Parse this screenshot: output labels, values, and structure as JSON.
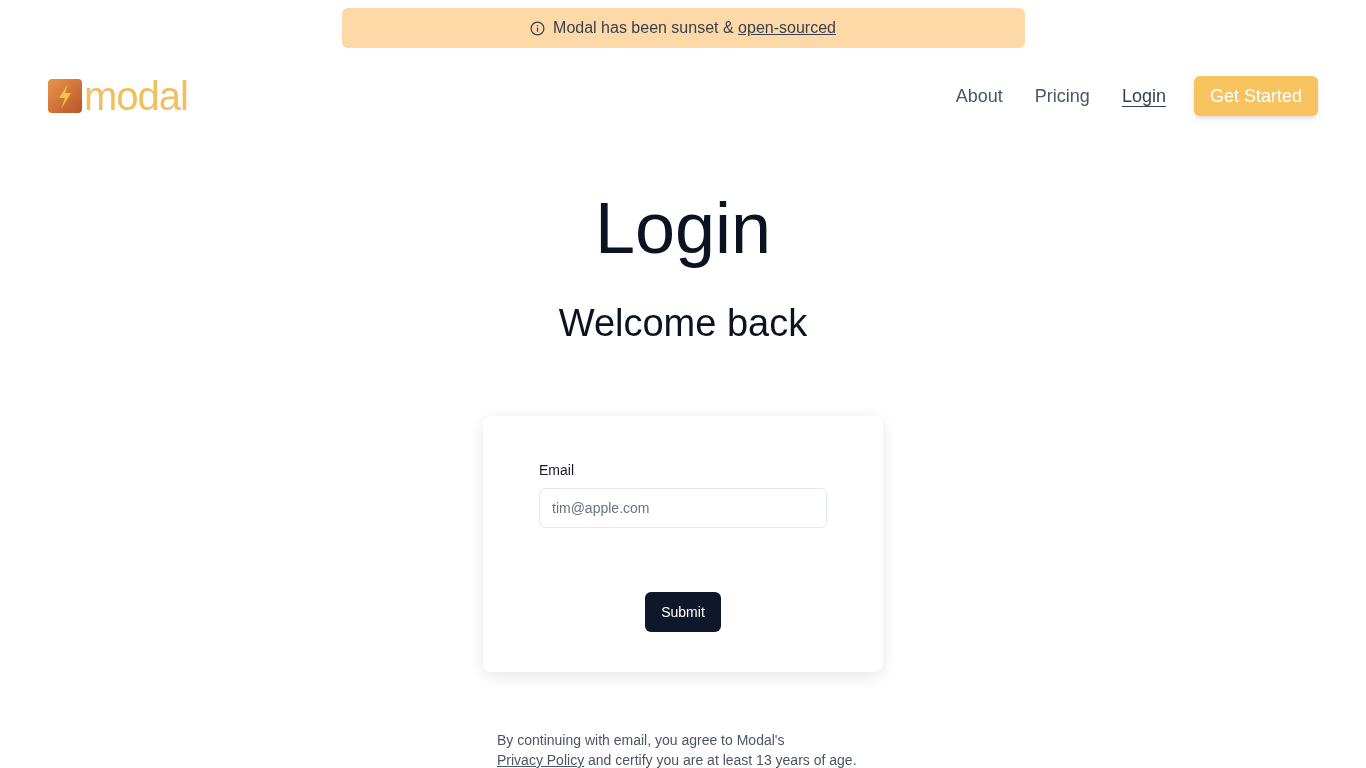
{
  "banner": {
    "text": "Modal has been sunset & ",
    "link": "open-sourced"
  },
  "logo": {
    "text": "modal"
  },
  "nav": [
    {
      "label": "About",
      "selected": false
    },
    {
      "label": "Pricing",
      "selected": false
    },
    {
      "label": "Login",
      "selected": true
    }
  ],
  "cta_button": "Get Started",
  "heading": "Login",
  "subheading": "Welcome back",
  "form": {
    "email_label": "Email",
    "email_placeholder": "tim@apple.com",
    "submit": "Submit"
  },
  "legal": {
    "before": "By continuing with email, you agree to Modal's ",
    "link": "Privacy Policy",
    "after": " and certify you are at least 13 years of age."
  }
}
